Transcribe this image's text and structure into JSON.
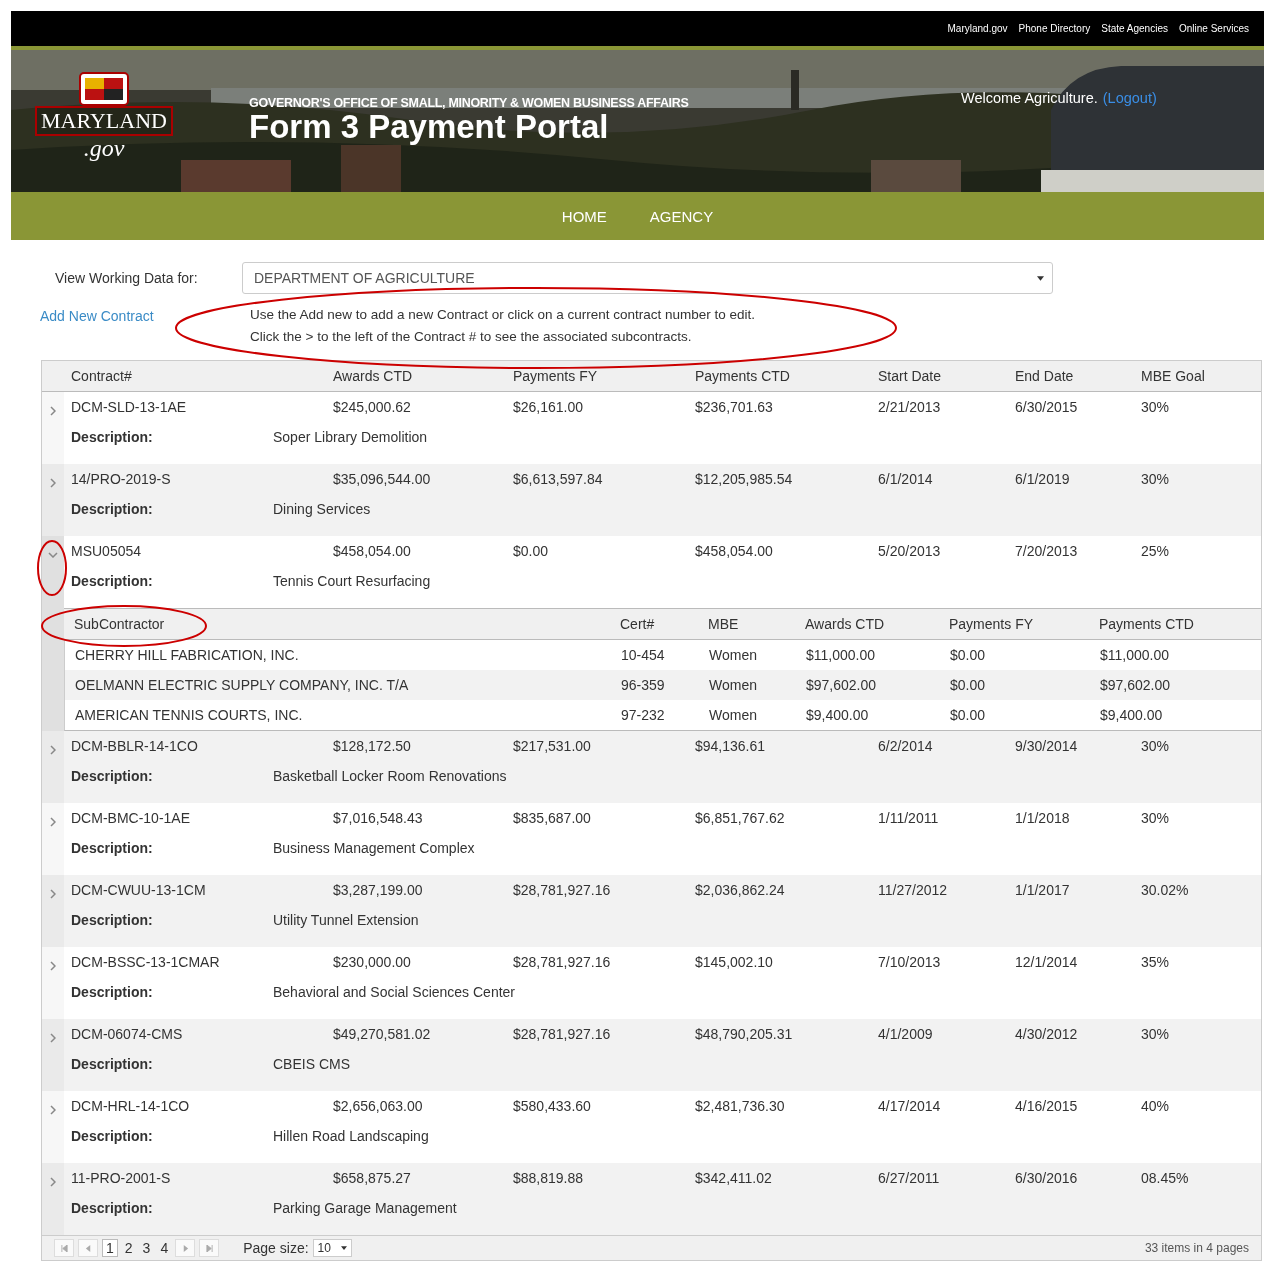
{
  "top_links": [
    "Maryland.gov",
    "Phone Directory",
    "State Agencies",
    "Online Services"
  ],
  "logo": {
    "name": "MARYLAND",
    "suffix": ".gov"
  },
  "banner": {
    "agency": "GOVERNOR'S OFFICE OF SMALL, MINORITY & WOMEN BUSINESS AFFAIRS",
    "title": "Form 3 Payment Portal",
    "welcome": "Welcome Agriculture.",
    "logout": "(Logout)"
  },
  "nav": [
    {
      "label": "HOME"
    },
    {
      "label": "AGENCY"
    }
  ],
  "filter": {
    "label": "View Working Data for:",
    "value": "DEPARTMENT OF AGRICULTURE"
  },
  "add_link": "Add New Contract",
  "instructions": [
    "Use the Add new to add a new Contract or click on a current contract number to edit.",
    "Click the > to the left of the Contract # to see the associated subcontracts."
  ],
  "table": {
    "columns": [
      "Contract#",
      "Awards CTD",
      "Payments FY",
      "Payments CTD",
      "Start Date",
      "End Date",
      "MBE Goal"
    ],
    "rows": [
      {
        "cells": [
          "DCM-SLD-13-1AE",
          "$245,000.62",
          "$26,161.00",
          "$236,701.63",
          "2/21/2013",
          "6/30/2015",
          "30%"
        ],
        "description_label": "Description:",
        "description": "Soper Library Demolition",
        "expanded": false
      },
      {
        "cells": [
          "14/PRO-2019-S",
          "$35,096,544.00",
          "$6,613,597.84",
          "$12,205,985.54",
          "6/1/2014",
          "6/1/2019",
          "30%"
        ],
        "description_label": "Description:",
        "description": "Dining Services",
        "expanded": false
      },
      {
        "cells": [
          "MSU05054",
          "$458,054.00",
          "$0.00",
          "$458,054.00",
          "5/20/2013",
          "7/20/2013",
          "25%"
        ],
        "description_label": "Description:",
        "description": "Tennis Court Resurfacing",
        "expanded": true,
        "subcontractors": {
          "columns": [
            "SubContractor",
            "Cert#",
            "MBE",
            "Awards CTD",
            "Payments FY",
            "Payments CTD"
          ],
          "rows": [
            [
              "CHERRY HILL FABRICATION, INC.",
              "10-454",
              "Women",
              "$11,000.00",
              "$0.00",
              "$11,000.00"
            ],
            [
              "OELMANN ELECTRIC SUPPLY COMPANY, INC. T/A",
              "96-359",
              "Women",
              "$97,602.00",
              "$0.00",
              "$97,602.00"
            ],
            [
              "AMERICAN TENNIS COURTS, INC.",
              "97-232",
              "Women",
              "$9,400.00",
              "$0.00",
              "$9,400.00"
            ]
          ]
        }
      },
      {
        "cells": [
          "DCM-BBLR-14-1CO",
          "$128,172.50",
          "$217,531.00",
          "$94,136.61",
          "6/2/2014",
          "9/30/2014",
          "30%"
        ],
        "description_label": "Description:",
        "description": "Basketball Locker Room Renovations",
        "expanded": false
      },
      {
        "cells": [
          "DCM-BMC-10-1AE",
          "$7,016,548.43",
          "$835,687.00",
          "$6,851,767.62",
          "1/11/2011",
          "1/1/2018",
          "30%"
        ],
        "description_label": "Description:",
        "description": "Business Management Complex",
        "expanded": false
      },
      {
        "cells": [
          "DCM-CWUU-13-1CM",
          "$3,287,199.00",
          "$28,781,927.16",
          "$2,036,862.24",
          "11/27/2012",
          "1/1/2017",
          "30.02%"
        ],
        "description_label": "Description:",
        "description": "Utility Tunnel Extension",
        "expanded": false
      },
      {
        "cells": [
          "DCM-BSSC-13-1CMAR",
          "$230,000.00",
          "$28,781,927.16",
          "$145,002.10",
          "7/10/2013",
          "12/1/2014",
          "35%"
        ],
        "description_label": "Description:",
        "description": "Behavioral and Social Sciences Center",
        "expanded": false
      },
      {
        "cells": [
          "DCM-06074-CMS",
          "$49,270,581.02",
          "$28,781,927.16",
          "$48,790,205.31",
          "4/1/2009",
          "4/30/2012",
          "30%"
        ],
        "description_label": "Description:",
        "description": "CBEIS CMS",
        "expanded": false
      },
      {
        "cells": [
          "DCM-HRL-14-1CO",
          "$2,656,063.00",
          "$580,433.60",
          "$2,481,736.30",
          "4/17/2014",
          "4/16/2015",
          "40%"
        ],
        "description_label": "Description:",
        "description": "Hillen Road Landscaping",
        "expanded": false
      },
      {
        "cells": [
          "11-PRO-2001-S",
          "$658,875.27",
          "$88,819.88",
          "$342,411.02",
          "6/27/2011",
          "6/30/2016",
          "08.45%"
        ],
        "description_label": "Description:",
        "description": "Parking Garage Management",
        "expanded": false
      }
    ]
  },
  "pager": {
    "pages": [
      {
        "label": "1",
        "selected": true
      },
      {
        "label": "2",
        "selected": false
      },
      {
        "label": "3",
        "selected": false
      },
      {
        "label": "4",
        "selected": false
      }
    ],
    "size_label": "Page size:",
    "size": "10",
    "summary": "33 items in 4 pages"
  }
}
